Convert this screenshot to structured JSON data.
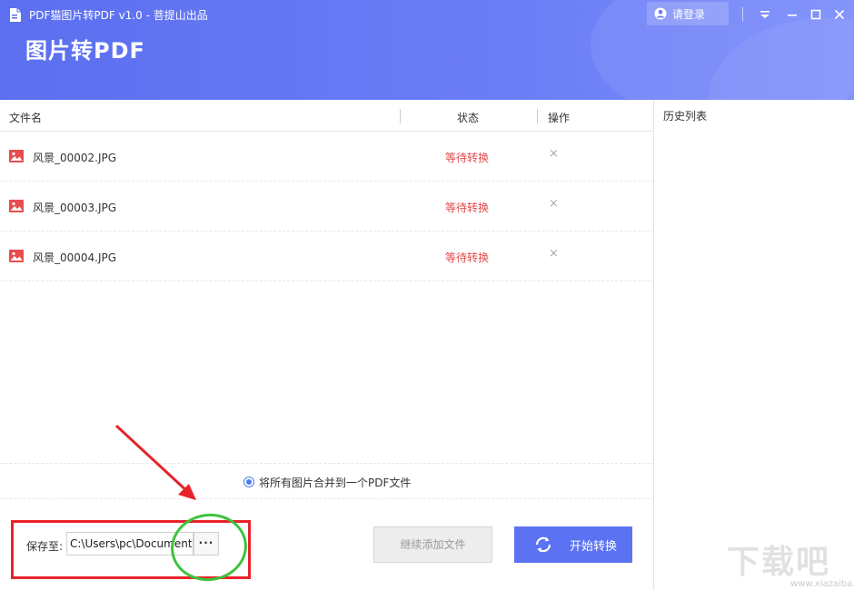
{
  "window": {
    "app_title": "PDF猫图片转PDF v1.0 - 菩提山出品",
    "big_title": "图片转PDF",
    "login_label": "请登录",
    "header_color": "#5b6ff0"
  },
  "table": {
    "col_filename": "文件名",
    "col_status": "状态",
    "col_action": "操作",
    "rows": [
      {
        "name": "风景_00002.JPG",
        "status": "等待转换",
        "action": "×"
      },
      {
        "name": "风景_00003.JPG",
        "status": "等待转换",
        "action": "×"
      },
      {
        "name": "风景_00004.JPG",
        "status": "等待转换",
        "action": "×"
      }
    ],
    "status_color": "#e04a4a"
  },
  "merge_option": {
    "label": "将所有图片合并到一个PDF文件",
    "checked": true
  },
  "save": {
    "label": "保存至:",
    "path": "C:\\Users\\pc\\Documents",
    "browse_label": "···"
  },
  "buttons": {
    "add_files": "继续添加文件",
    "start": "开始转换",
    "start_color": "#5b73f2"
  },
  "history": {
    "title": "历史列表"
  },
  "watermark": {
    "text": "下载吧",
    "url": "www.xiazaiba.com"
  },
  "icons": {
    "app": "pdf-cat-app-icon",
    "user": "user-icon",
    "image": "image-file-icon",
    "refresh": "refresh-icon"
  }
}
